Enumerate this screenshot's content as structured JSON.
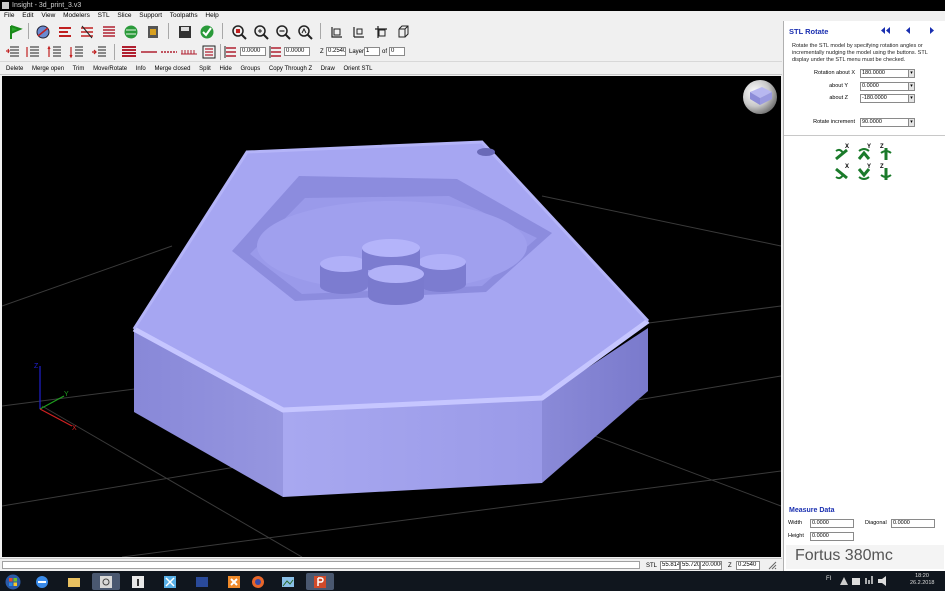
{
  "window": {
    "title": "Insight - 3d_print_3.v3"
  },
  "menu": [
    "File",
    "Edit",
    "View",
    "Modelers",
    "STL",
    "Slice",
    "Support",
    "Toolpaths",
    "Help"
  ],
  "toolbar2": {
    "field1": "0.0000",
    "field2": "0.0000",
    "z_label": "Z",
    "z_value": "0.2540",
    "layer_label": "Layer",
    "layer_value": "1",
    "of_label": "of",
    "of_value": "0"
  },
  "edit_toolbar": [
    "Delete",
    "Merge open",
    "Trim",
    "Move/Rotate",
    "Info",
    "Merge closed",
    "Split",
    "Hide",
    "Groups",
    "Copy Through Z",
    "Draw",
    "Orient STL"
  ],
  "status": {
    "mode": "STL",
    "x": "55.8149",
    "y": "55.7200",
    "z_coord": "20.0000",
    "z_label": "Z",
    "z_value": "0.2540"
  },
  "panel": {
    "title": "STL Rotate",
    "description": "Rotate the STL model by specifying rotation angles or incrementally nudging the model using the buttons. STL display under the STL menu must be checked.",
    "fields": [
      {
        "label": "Rotation about X",
        "value": "180.0000"
      },
      {
        "label": "about Y",
        "value": "0.0000"
      },
      {
        "label": "about Z",
        "value": "-180.0000"
      }
    ],
    "increment": {
      "label": "Rotate increment",
      "value": "90.0000"
    },
    "axis_labels": [
      "X",
      "Y",
      "Z"
    ],
    "measure": {
      "title": "Measure Data",
      "width_label": "Width",
      "width_value": "0.0000",
      "diagonal_label": "Diagonal",
      "diagonal_value": "0.0000",
      "height_label": "Height",
      "height_value": "0.0000"
    },
    "brand": "Fortus 380mc"
  },
  "axes": {
    "x": "X",
    "y": "Y",
    "z": "Z"
  },
  "taskbar": {
    "lang": "FI",
    "time": "18:20",
    "date": "26.2.2018"
  },
  "colors": {
    "model": "#9c9ce6",
    "panel_title": "#1a2fb0",
    "axis_x": "#d02020",
    "axis_y": "#1fa01f",
    "axis_z": "#2020d0"
  }
}
